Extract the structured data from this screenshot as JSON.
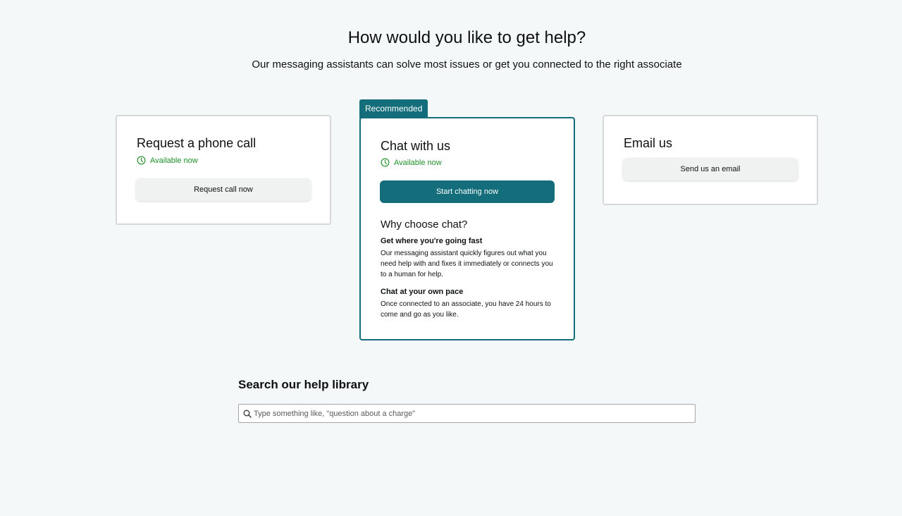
{
  "header": {
    "title": "How would you like to get help?",
    "subtitle": "Our messaging assistants can solve most issues or get you connected to the right associate"
  },
  "phone_card": {
    "title": "Request a phone call",
    "availability": "Available now",
    "button_label": "Request call now"
  },
  "chat_card": {
    "badge": "Recommended",
    "title": "Chat with us",
    "availability": "Available now",
    "button_label": "Start chatting now",
    "why_heading": "Why choose chat?",
    "reasons": [
      {
        "title": "Get where you're going fast",
        "text": "Our messaging assistant quickly figures out what you need help with and fixes it immediately or connects you to a human for help."
      },
      {
        "title": "Chat at your own pace",
        "text": "Once connected to an associate, you have 24 hours to come and go as you like."
      }
    ]
  },
  "email_card": {
    "title": "Email us",
    "button_label": "Send us an email"
  },
  "search": {
    "heading": "Search our help library",
    "placeholder": "Type something like, \"question about a charge\"",
    "icon": "search-icon"
  },
  "colors": {
    "background": "#f5f8f9",
    "accent": "#136d7b",
    "available": "#1f8f28",
    "secondary_button": "#f0f1f1"
  }
}
